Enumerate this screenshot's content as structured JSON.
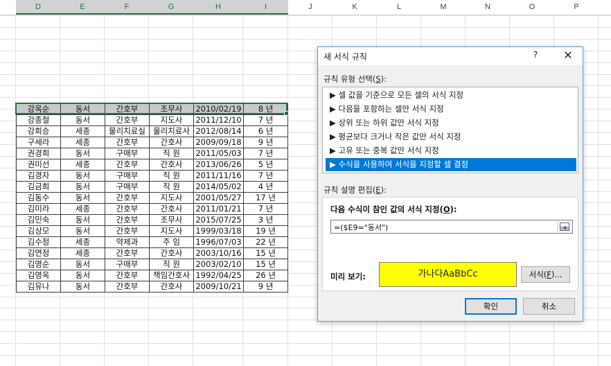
{
  "sheet": {
    "columns": [
      "D",
      "E",
      "F",
      "G",
      "H",
      "I",
      "J",
      "K",
      "L",
      "M",
      "N",
      "O",
      "P"
    ],
    "rows": [
      [
        "강옥순",
        "동서",
        "간호부",
        "조무사",
        "2010/02/19",
        "8 년"
      ],
      [
        "강종철",
        "동서",
        "간호부",
        "지도사",
        "2011/12/10",
        "7 년"
      ],
      [
        "강희승",
        "세종",
        "물리치료실",
        "물리치료사",
        "2012/08/14",
        "6 년"
      ],
      [
        "구세라",
        "세종",
        "간호부",
        "간호사",
        "2009/09/18",
        "9 년"
      ],
      [
        "권경희",
        "동서",
        "구매부",
        "직 원",
        "2011/05/03",
        "7 년"
      ],
      [
        "권미선",
        "세종",
        "간호부",
        "간호사",
        "2013/06/26",
        "5 년"
      ],
      [
        "김경자",
        "동서",
        "구매부",
        "직 원",
        "2011/11/16",
        "7 년"
      ],
      [
        "김금희",
        "동서",
        "구매부",
        "직 원",
        "2014/05/02",
        "4 년"
      ],
      [
        "김동수",
        "동서",
        "간호부",
        "지도사",
        "2001/05/27",
        "17 년"
      ],
      [
        "김미라",
        "세종",
        "간호부",
        "간호사",
        "2011/01/21",
        "7 년"
      ],
      [
        "김민숙",
        "동서",
        "간호부",
        "조무사",
        "2015/07/25",
        "3 년"
      ],
      [
        "김상모",
        "동서",
        "간호부",
        "지도사",
        "1999/03/18",
        "19 년"
      ],
      [
        "김수정",
        "세종",
        "약제과",
        "주 임",
        "1996/07/03",
        "22 년"
      ],
      [
        "김연정",
        "세종",
        "간호부",
        "간호사",
        "2003/10/16",
        "15 년"
      ],
      [
        "김영순",
        "동서",
        "구매부",
        "직 원",
        "2003/02/10",
        "15 년"
      ],
      [
        "김영옥",
        "동서",
        "간호부",
        "책임간호사",
        "1992/04/25",
        "26 년"
      ],
      [
        "김유나",
        "동서",
        "간호부",
        "간호사",
        "2009/10/21",
        "9 년"
      ]
    ]
  },
  "dialog": {
    "title": "새 서식 규칙",
    "help": "?",
    "close": "✕",
    "rule_type_label": "규칙 유형 선택(",
    "rule_type_key": "S",
    "rule_type_suffix": "):",
    "rule_types": [
      "▶ 셀 값을 기준으로 모든 셀의 서식 지정",
      "▶ 다음을 포함하는 셀만 서식 지정",
      "▶ 상위 또는 하위 값만 서식 지정",
      "▶ 평균보다 크거나 작은 값만 서식 지정",
      "▶ 고유 또는 중복 값만 서식 지정",
      "▶ 수식을 사용하여 서식을 지정할 셀 결정"
    ],
    "edit_label": "규칙 설명 편집(",
    "edit_key": "E",
    "edit_suffix": "):",
    "formula_label": "다음 수식이 참인 값의 서식 지정(",
    "formula_key": "O",
    "formula_suffix": "):",
    "formula_value": "=($E9=\"동서\")",
    "preview_label": "미리 보기:",
    "preview_text": "가나다AaBbCc",
    "preview_color": "#ffff00",
    "format_button": "서식(",
    "format_key": "F",
    "format_suffix": ")...",
    "ok_button": "확인",
    "cancel_button": "취소"
  }
}
